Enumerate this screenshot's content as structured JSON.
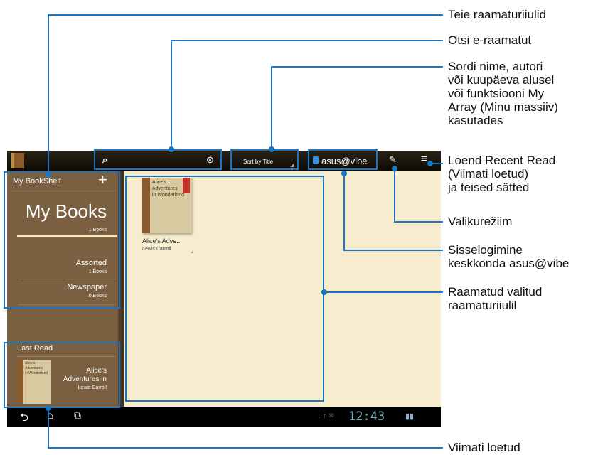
{
  "screen": {
    "search": {
      "placeholder": ""
    },
    "sort_label": "Sort by Title",
    "asus_vibe_label": "asus@vibe",
    "sidebar": {
      "title": "My BookShelf",
      "add_symbol": "+",
      "my_books": {
        "title": "My Books",
        "count": "1 Books"
      },
      "shelves": [
        {
          "name": "Assorted",
          "count": "1 Books"
        },
        {
          "name": "Newspaper",
          "count": "0 Books"
        }
      ],
      "last_read_title": "Last Read",
      "last_read_book": {
        "line1": "Alice's",
        "line2": "Adventures in",
        "author": "Lewis Carroll",
        "cover_line1": "Alice's",
        "cover_line2": "Adventures",
        "cover_line3": "in Wonderland"
      }
    },
    "book": {
      "cover_line1": "Alice's",
      "cover_line2": "Adventures",
      "cover_line3": "in Wonderland",
      "title": "Alice's Adve...",
      "author": "Lewis Carroll"
    },
    "clock": "12:43"
  },
  "callouts": {
    "bookshelves": "Teie raamaturiiulid",
    "search_ebooks": "Otsi e-raamatut",
    "sort": [
      "Sordi nime, autori",
      "või kuupäeva alusel",
      "või funktsiooni My",
      "Array (Minu massiiv)",
      "kasutades"
    ],
    "recent_read": [
      "Loend Recent Read",
      "(Viimati loetud)",
      "ja teised sätted"
    ],
    "selection_mode": "Valikurežiim",
    "asus_vibe_login": [
      "Sisselogimine",
      "keskkonda asus@vibe"
    ],
    "books_on_shelf": [
      "Raamatud valitud",
      "raamaturiiulil"
    ],
    "last_read": "Viimati loetud"
  },
  "colors": {
    "callout_blue": "#1a75c2",
    "sidebar": "#7a5f40",
    "background": "#f7eccd"
  }
}
